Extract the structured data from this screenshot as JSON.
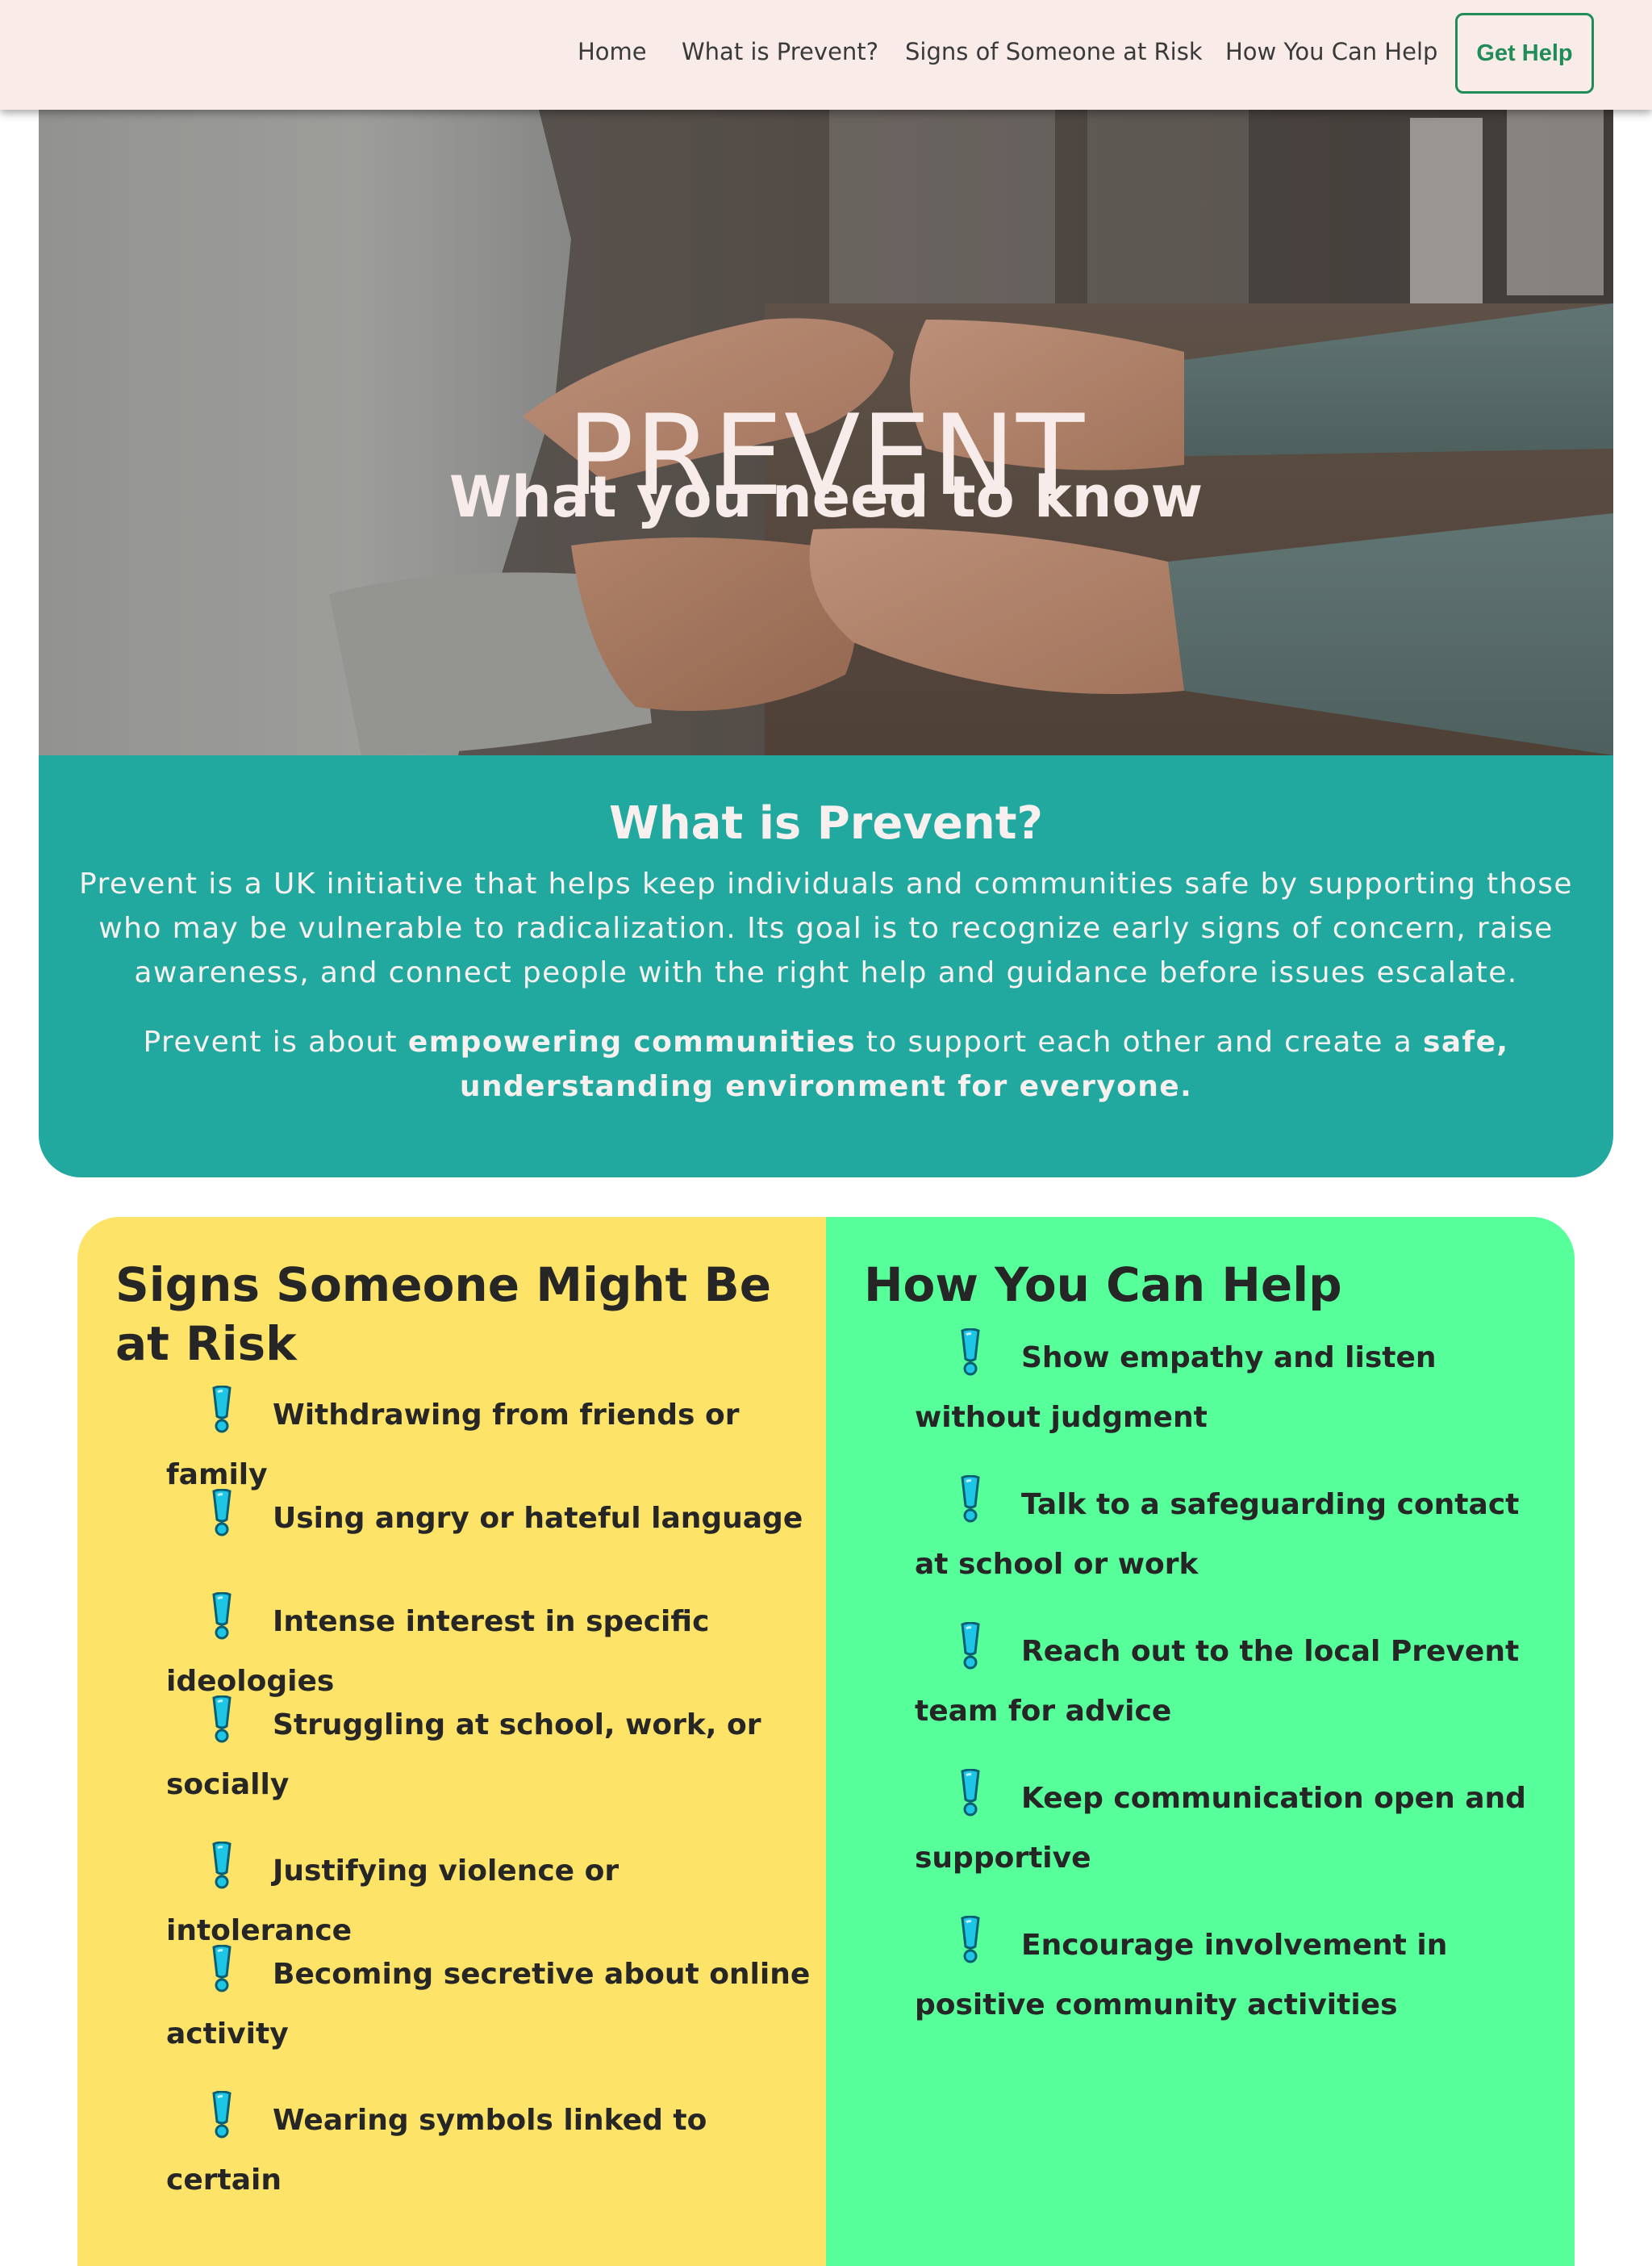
{
  "nav": {
    "links": [
      "Home",
      "What is Prevent?",
      "Signs of Someone at Risk",
      "How You Can Help"
    ],
    "cta": "Get Help"
  },
  "hero": {
    "title": "PREVENT",
    "subtitle": "What you need to know",
    "image_icon": "holding-hands-photo"
  },
  "about": {
    "heading": "What is Prevent?",
    "paragraph": "Prevent is a UK initiative that helps keep individuals and communities safe by supporting those who may be vulnerable to radicalization. Its goal is to recognize early signs of concern, raise awareness, and connect people with the right help and guidance before issues escalate.",
    "p2_start": "Prevent is about ",
    "p2_bold1": "empowering communities",
    "p2_middle": " to support each other and create a ",
    "p2_bold2": "safe, understanding environment for everyone."
  },
  "signs": {
    "heading": "Signs Someone Might Be at Risk",
    "icon": "exclamation-icon",
    "items": [
      "Withdrawing from friends or family",
      "Using angry or hateful language",
      "Intense interest in specific ideologies",
      "Struggling at school, work, or socially",
      "Justifying violence or intolerance",
      "Becoming secretive about online activity",
      "Wearing symbols linked to certain"
    ]
  },
  "help": {
    "heading": "How You Can Help",
    "icon": "exclamation-icon",
    "items": [
      "Show empathy and listen without judgment",
      "Talk to a safeguarding contact at school or work",
      "Reach out to the local Prevent team for advice",
      "Keep communication open and supportive",
      "Encourage involvement in positive community activities"
    ]
  },
  "colors": {
    "nav_bg": "#f8ebe8",
    "accent_green": "#1f8c59",
    "teal": "#21a99f",
    "yellow": "#fde367",
    "mint": "#57ff9a",
    "icon_cyan": "#1ec6e6"
  }
}
